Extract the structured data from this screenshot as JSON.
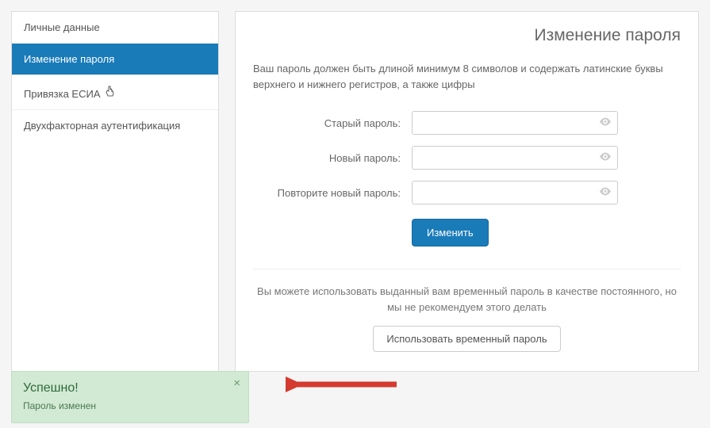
{
  "sidebar": {
    "items": [
      {
        "label": "Личные данные"
      },
      {
        "label": "Изменение пароля"
      },
      {
        "label": "Привязка ЕСИА"
      },
      {
        "label": "Двухфакторная аутентификация"
      }
    ]
  },
  "page": {
    "title": "Изменение пароля",
    "help": "Ваш пароль должен быть длиной минимум 8 символов и содержать латинские буквы верхнего и нижнего регистров, а также цифры"
  },
  "form": {
    "old_label": "Старый пароль:",
    "new_label": "Новый пароль:",
    "repeat_label": "Повторите новый пароль:",
    "submit": "Изменить"
  },
  "secondary": {
    "text": "Вы можете использовать выданный вам временный пароль в качестве постоянного, но мы не рекомендуем этого делать",
    "button": "Использовать временный пароль"
  },
  "toast": {
    "title": "Успешно!",
    "message": "Пароль изменен"
  }
}
